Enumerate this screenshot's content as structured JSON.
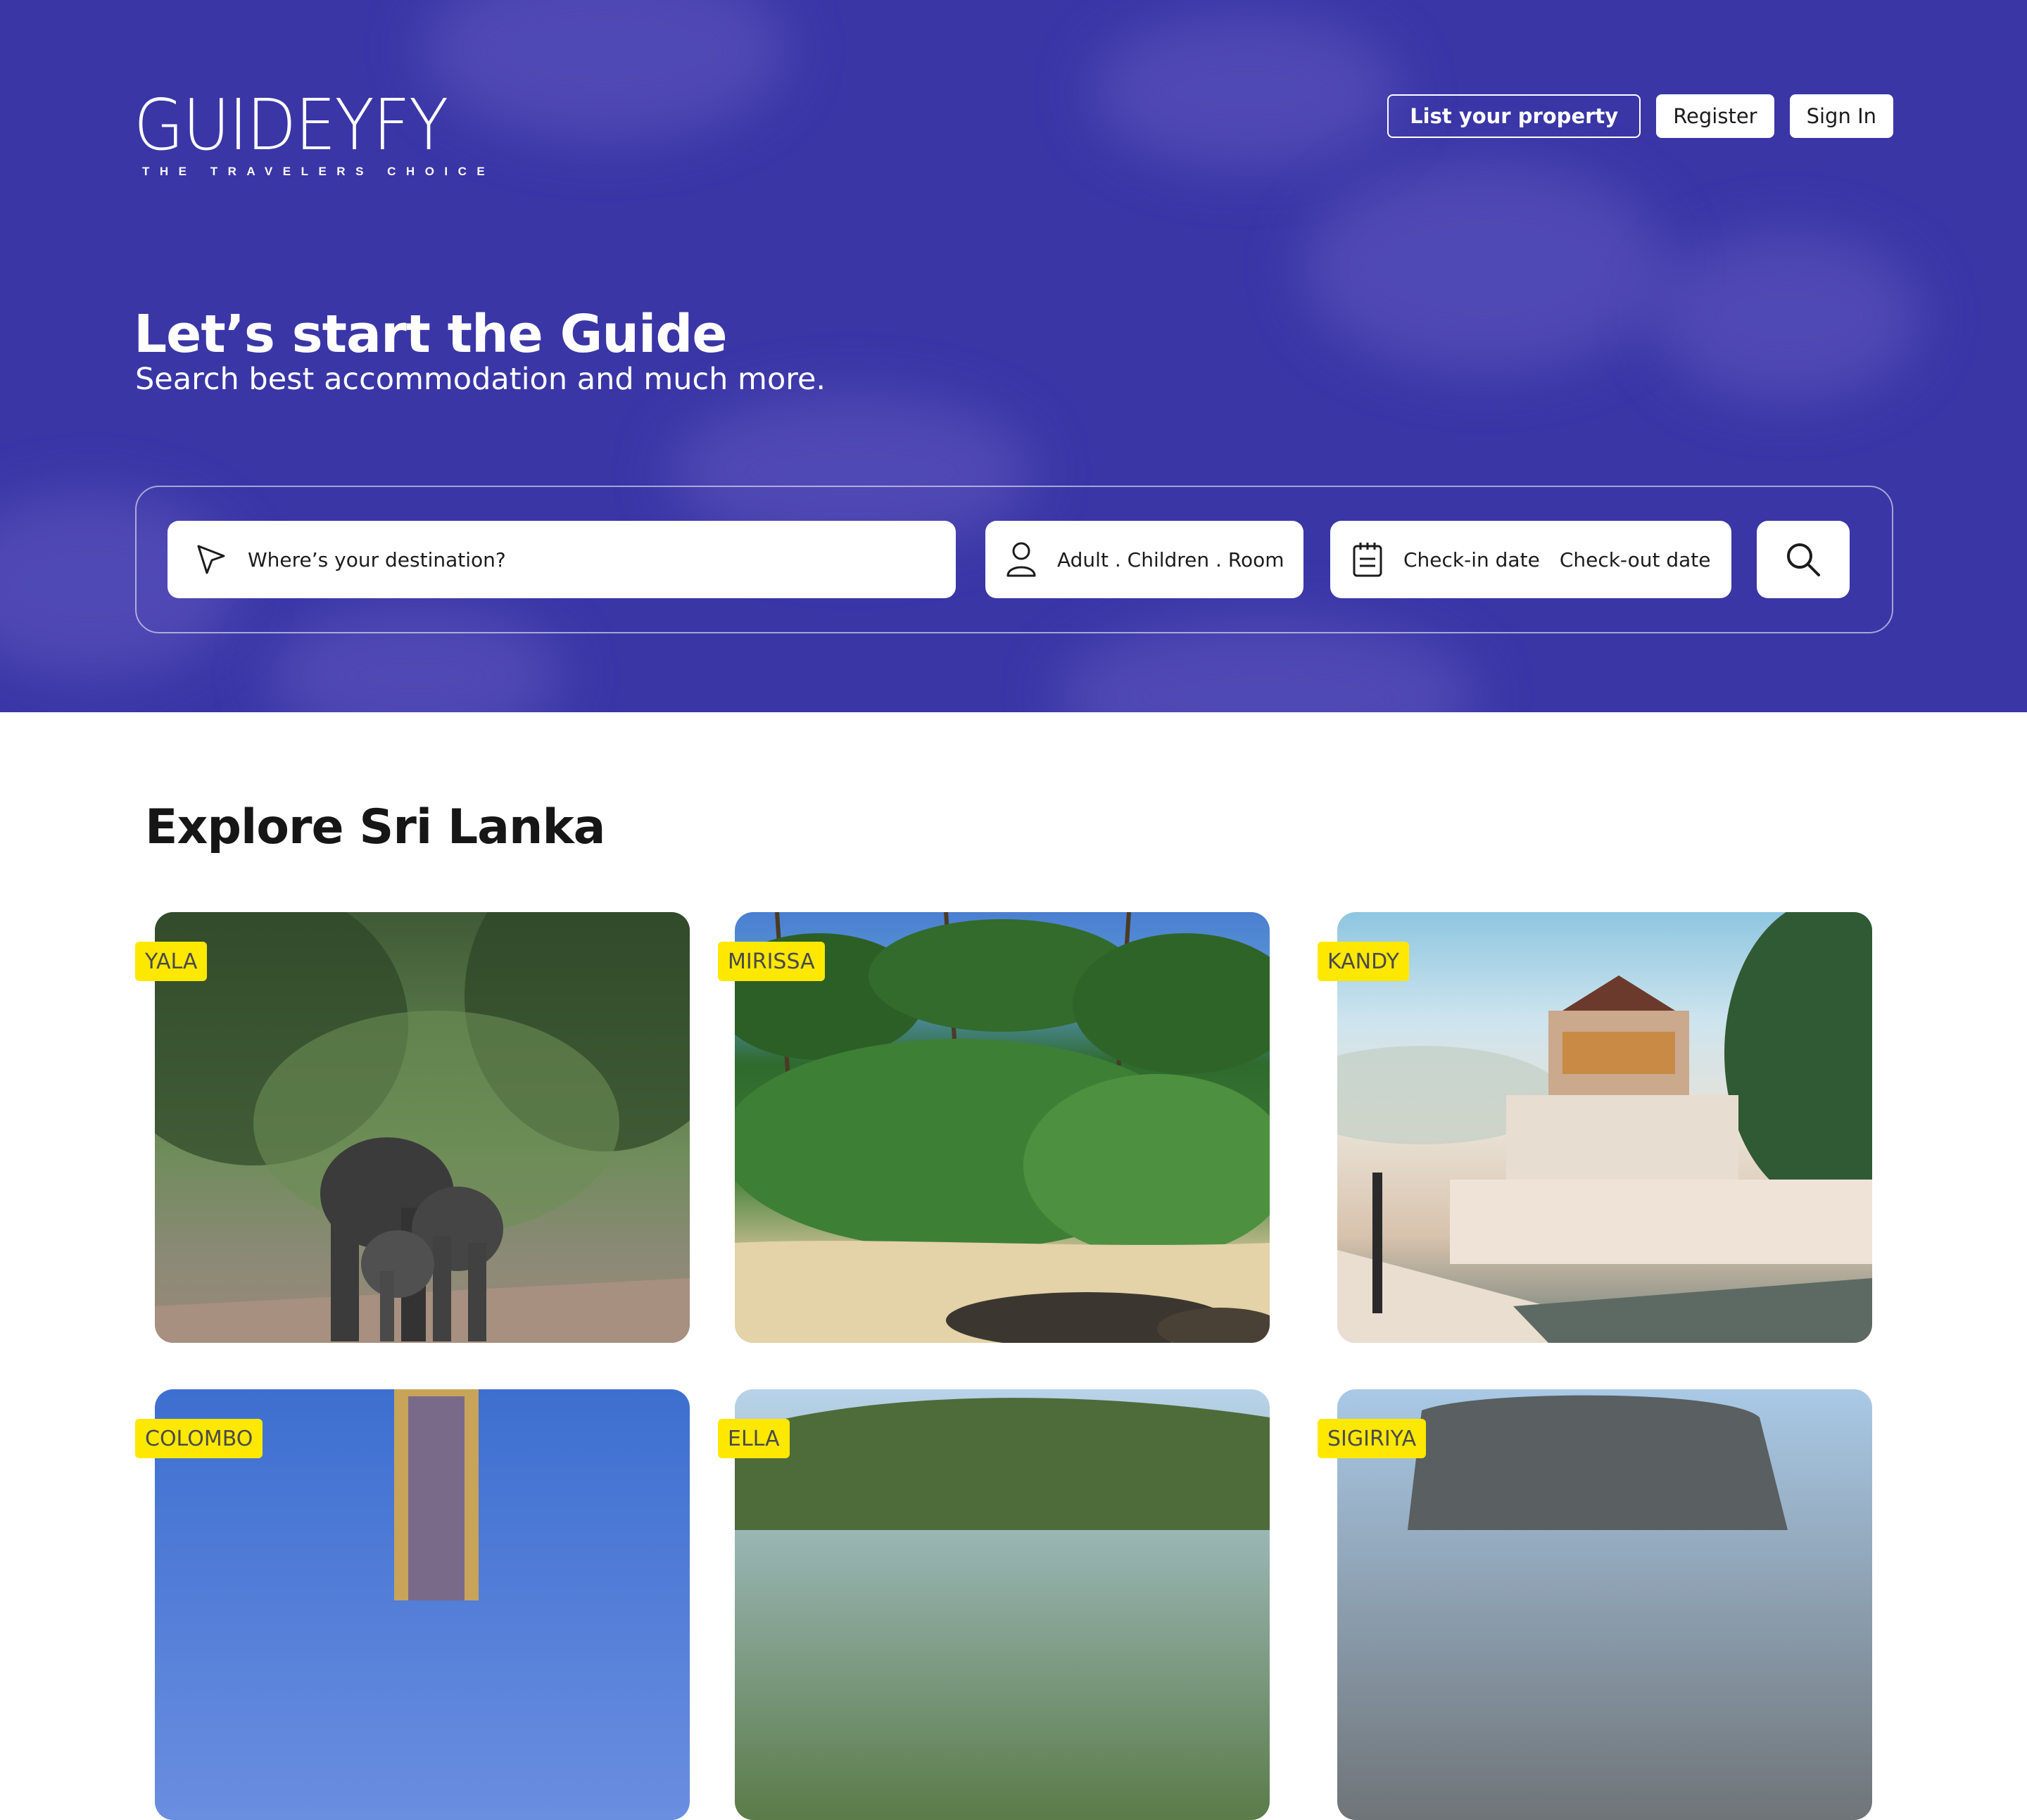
{
  "brand": {
    "name": "GUIDEYFY",
    "tagline": "THE TRAVELERS CHOICE"
  },
  "nav": {
    "list_property": "List your property",
    "register": "Register",
    "sign_in": "Sign In"
  },
  "hero": {
    "title": "Let’s start the Guide",
    "subtitle": "Search best accommodation and much more."
  },
  "search": {
    "destination_placeholder": "Where’s your destination?",
    "guests_label": "Adult . Children . Room",
    "checkin_label": "Check-in date",
    "checkout_label": "Check-out date"
  },
  "explore": {
    "title": "Explore Sri Lanka",
    "destinations": [
      "YALA",
      "MIRISSA",
      "KANDY",
      "COLOMBO",
      "ELLA",
      "SIGIRIYA"
    ]
  },
  "colors": {
    "hero_bg": "#3a36a6",
    "tag_bg": "#ffe800"
  }
}
